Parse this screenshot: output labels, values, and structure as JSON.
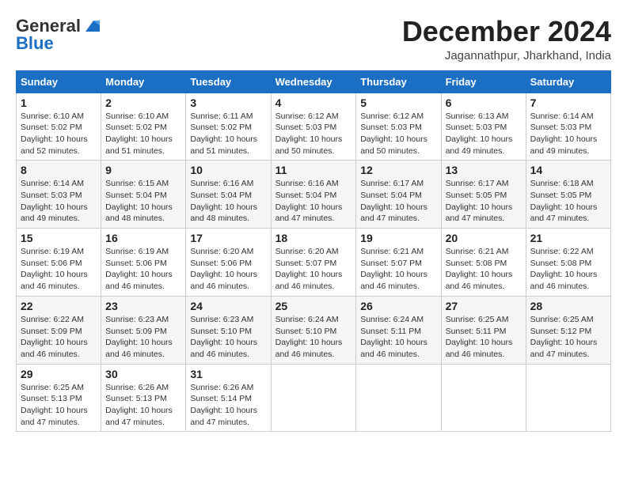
{
  "logo": {
    "line1": "General",
    "line2": "Blue"
  },
  "title": {
    "month": "December 2024",
    "location": "Jagannathpur, Jharkhand, India"
  },
  "headers": [
    "Sunday",
    "Monday",
    "Tuesday",
    "Wednesday",
    "Thursday",
    "Friday",
    "Saturday"
  ],
  "weeks": [
    [
      {
        "day": "1",
        "sunrise": "6:10 AM",
        "sunset": "5:02 PM",
        "daylight": "10 hours and 52 minutes."
      },
      {
        "day": "2",
        "sunrise": "6:10 AM",
        "sunset": "5:02 PM",
        "daylight": "10 hours and 51 minutes."
      },
      {
        "day": "3",
        "sunrise": "6:11 AM",
        "sunset": "5:02 PM",
        "daylight": "10 hours and 51 minutes."
      },
      {
        "day": "4",
        "sunrise": "6:12 AM",
        "sunset": "5:03 PM",
        "daylight": "10 hours and 50 minutes."
      },
      {
        "day": "5",
        "sunrise": "6:12 AM",
        "sunset": "5:03 PM",
        "daylight": "10 hours and 50 minutes."
      },
      {
        "day": "6",
        "sunrise": "6:13 AM",
        "sunset": "5:03 PM",
        "daylight": "10 hours and 49 minutes."
      },
      {
        "day": "7",
        "sunrise": "6:14 AM",
        "sunset": "5:03 PM",
        "daylight": "10 hours and 49 minutes."
      }
    ],
    [
      {
        "day": "8",
        "sunrise": "6:14 AM",
        "sunset": "5:03 PM",
        "daylight": "10 hours and 49 minutes."
      },
      {
        "day": "9",
        "sunrise": "6:15 AM",
        "sunset": "5:04 PM",
        "daylight": "10 hours and 48 minutes."
      },
      {
        "day": "10",
        "sunrise": "6:16 AM",
        "sunset": "5:04 PM",
        "daylight": "10 hours and 48 minutes."
      },
      {
        "day": "11",
        "sunrise": "6:16 AM",
        "sunset": "5:04 PM",
        "daylight": "10 hours and 47 minutes."
      },
      {
        "day": "12",
        "sunrise": "6:17 AM",
        "sunset": "5:04 PM",
        "daylight": "10 hours and 47 minutes."
      },
      {
        "day": "13",
        "sunrise": "6:17 AM",
        "sunset": "5:05 PM",
        "daylight": "10 hours and 47 minutes."
      },
      {
        "day": "14",
        "sunrise": "6:18 AM",
        "sunset": "5:05 PM",
        "daylight": "10 hours and 47 minutes."
      }
    ],
    [
      {
        "day": "15",
        "sunrise": "6:19 AM",
        "sunset": "5:06 PM",
        "daylight": "10 hours and 46 minutes."
      },
      {
        "day": "16",
        "sunrise": "6:19 AM",
        "sunset": "5:06 PM",
        "daylight": "10 hours and 46 minutes."
      },
      {
        "day": "17",
        "sunrise": "6:20 AM",
        "sunset": "5:06 PM",
        "daylight": "10 hours and 46 minutes."
      },
      {
        "day": "18",
        "sunrise": "6:20 AM",
        "sunset": "5:07 PM",
        "daylight": "10 hours and 46 minutes."
      },
      {
        "day": "19",
        "sunrise": "6:21 AM",
        "sunset": "5:07 PM",
        "daylight": "10 hours and 46 minutes."
      },
      {
        "day": "20",
        "sunrise": "6:21 AM",
        "sunset": "5:08 PM",
        "daylight": "10 hours and 46 minutes."
      },
      {
        "day": "21",
        "sunrise": "6:22 AM",
        "sunset": "5:08 PM",
        "daylight": "10 hours and 46 minutes."
      }
    ],
    [
      {
        "day": "22",
        "sunrise": "6:22 AM",
        "sunset": "5:09 PM",
        "daylight": "10 hours and 46 minutes."
      },
      {
        "day": "23",
        "sunrise": "6:23 AM",
        "sunset": "5:09 PM",
        "daylight": "10 hours and 46 minutes."
      },
      {
        "day": "24",
        "sunrise": "6:23 AM",
        "sunset": "5:10 PM",
        "daylight": "10 hours and 46 minutes."
      },
      {
        "day": "25",
        "sunrise": "6:24 AM",
        "sunset": "5:10 PM",
        "daylight": "10 hours and 46 minutes."
      },
      {
        "day": "26",
        "sunrise": "6:24 AM",
        "sunset": "5:11 PM",
        "daylight": "10 hours and 46 minutes."
      },
      {
        "day": "27",
        "sunrise": "6:25 AM",
        "sunset": "5:11 PM",
        "daylight": "10 hours and 46 minutes."
      },
      {
        "day": "28",
        "sunrise": "6:25 AM",
        "sunset": "5:12 PM",
        "daylight": "10 hours and 47 minutes."
      }
    ],
    [
      {
        "day": "29",
        "sunrise": "6:25 AM",
        "sunset": "5:13 PM",
        "daylight": "10 hours and 47 minutes."
      },
      {
        "day": "30",
        "sunrise": "6:26 AM",
        "sunset": "5:13 PM",
        "daylight": "10 hours and 47 minutes."
      },
      {
        "day": "31",
        "sunrise": "6:26 AM",
        "sunset": "5:14 PM",
        "daylight": "10 hours and 47 minutes."
      },
      null,
      null,
      null,
      null
    ]
  ]
}
